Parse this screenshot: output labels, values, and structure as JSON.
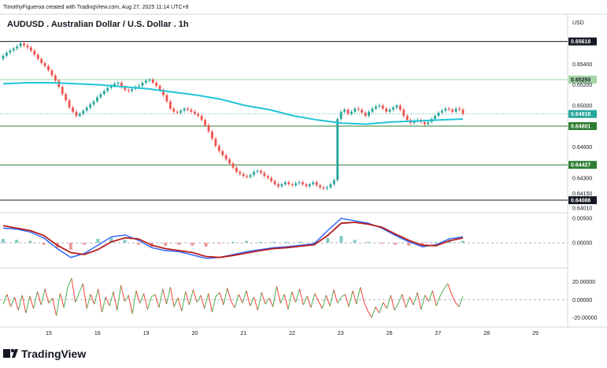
{
  "header": {
    "credit": "TimothyFigueroa created with TradingView.com, Aug 27, 2025 11:14 UTC+8",
    "symbol_title": "AUDUSD . Australian Dollar / U.S. Dollar . 1h",
    "currency": "USD"
  },
  "footer": {
    "logo_text": "TradingView"
  },
  "colors": {
    "up_candle": "#26a69a",
    "down_candle": "#ef5350",
    "sma": "#22c4d8",
    "resistance": "#a5d6a7",
    "support": "#2e7d32",
    "macd": "#2962ff",
    "signal": "#2e9f3a",
    "signal_dn": "#b71c1c",
    "osc_up": "#4caf50",
    "osc_dn": "#f44336"
  },
  "chart_data": [
    {
      "type": "candlestick",
      "symbol": "AUDUSD",
      "interval": "1h",
      "x_tick_labels": [
        "15",
        "16",
        "19",
        "20",
        "21",
        "22",
        "23",
        "26",
        "27",
        "28",
        "29"
      ],
      "y_tick_labels": [
        "0.65400",
        "0.65200",
        "0.65000",
        "0.64600",
        "0.64300",
        "0.64150",
        "0.64010"
      ],
      "ylim": [
        0.6398,
        0.6579
      ],
      "horizontal_levels": [
        {
          "value": 0.65618,
          "label": "0.65618",
          "style": "black"
        },
        {
          "value": 0.6525,
          "label": "0.65250",
          "style": "light-green"
        },
        {
          "value": 0.64801,
          "label": "0.64801",
          "style": "green"
        },
        {
          "value": 0.64427,
          "label": "0.64427",
          "style": "green"
        },
        {
          "value": 0.64086,
          "label": "0.64086",
          "style": "black"
        }
      ],
      "last_price": {
        "value": 0.64918,
        "label": "0.64918"
      },
      "close_series": [
        0.6548,
        0.6551,
        0.6553,
        0.6555,
        0.6557,
        0.656,
        0.6558,
        0.6556,
        0.6553,
        0.6549,
        0.6545,
        0.6541,
        0.6538,
        0.6534,
        0.6529,
        0.6524,
        0.6518,
        0.6511,
        0.6505,
        0.6498,
        0.6494,
        0.649,
        0.6492,
        0.6495,
        0.6498,
        0.6501,
        0.6504,
        0.6508,
        0.6511,
        0.6514,
        0.6517,
        0.6519,
        0.6521,
        0.6522,
        0.6518,
        0.6515,
        0.6514,
        0.6516,
        0.6518,
        0.6519,
        0.6522,
        0.6524,
        0.6525,
        0.6522,
        0.6519,
        0.6515,
        0.651,
        0.6504,
        0.6497,
        0.6494,
        0.6493,
        0.6495,
        0.6497,
        0.6496,
        0.6494,
        0.6492,
        0.649,
        0.6486,
        0.6481,
        0.6475,
        0.6468,
        0.6461,
        0.6456,
        0.6452,
        0.6448,
        0.6444,
        0.644,
        0.6436,
        0.6434,
        0.6432,
        0.6431,
        0.6433,
        0.6436,
        0.6437,
        0.6435,
        0.6432,
        0.643,
        0.6427,
        0.6424,
        0.6422,
        0.6424,
        0.6426,
        0.6424,
        0.6423,
        0.6425,
        0.6426,
        0.6424,
        0.6422,
        0.6424,
        0.6426,
        0.6423,
        0.6421,
        0.642,
        0.6421,
        0.6424,
        0.6428,
        0.6487,
        0.6494,
        0.6496,
        0.6492,
        0.6494,
        0.6497,
        0.6496,
        0.6493,
        0.649,
        0.6494,
        0.6497,
        0.6499,
        0.65,
        0.6497,
        0.6494,
        0.6496,
        0.6498,
        0.65,
        0.6496,
        0.649,
        0.6486,
        0.6483,
        0.6485,
        0.6486,
        0.6484,
        0.6482,
        0.6484,
        0.6487,
        0.649,
        0.6493,
        0.6495,
        0.6497,
        0.6496,
        0.6494,
        0.6497,
        0.6496,
        0.6492
      ],
      "sma_series": [
        0.6521,
        0.6522,
        0.6522,
        0.6521,
        0.652,
        0.6518,
        0.6516,
        0.6513,
        0.651,
        0.6506,
        0.65,
        0.6496,
        0.649,
        0.6486,
        0.6483,
        0.6482,
        0.6484,
        0.6485,
        0.6486,
        0.6487
      ]
    },
    {
      "type": "line",
      "name": "MACD",
      "y_tick_labels": [
        "0.00500",
        "0.00000"
      ],
      "ylim": [
        -0.0045,
        0.0055
      ],
      "series": [
        {
          "values": [
            0.003,
            0.0028,
            0.0022,
            0.001,
            -0.0012,
            -0.003,
            -0.0022,
            -0.0005,
            0.0012,
            0.0016,
            0.0005,
            -0.001,
            -0.0016,
            -0.0018,
            -0.0025,
            -0.0032,
            -0.003,
            -0.0024,
            -0.0018,
            -0.0014,
            -0.001,
            -0.0008,
            -0.0005,
            -0.0002,
            0.0025,
            0.005,
            0.0045,
            0.004,
            0.003,
            0.0015,
            0.0002,
            -0.0008,
            -0.0004,
            0.0008,
            0.0012
          ]
        },
        {
          "values": [
            0.0035,
            0.003,
            0.0025,
            0.0015,
            -0.0005,
            -0.002,
            -0.0024,
            -0.0014,
            0.0002,
            0.001,
            0.0008,
            -0.0005,
            -0.0012,
            -0.0016,
            -0.002,
            -0.0028,
            -0.003,
            -0.0026,
            -0.0021,
            -0.0016,
            -0.0012,
            -0.001,
            -0.0007,
            -0.0004,
            0.0015,
            0.004,
            0.0042,
            0.0038,
            0.0032,
            0.0018,
            0.0005,
            -0.0005,
            -0.0006,
            0.0004,
            0.001
          ]
        }
      ],
      "histogram": [
        0.0008,
        0.0006,
        0.0004,
        -0.0004,
        -0.001,
        -0.0014,
        -0.0004,
        0.0008,
        0.001,
        0.0006,
        -0.0004,
        -0.0008,
        -0.0006,
        -0.0004,
        -0.0006,
        -0.0008,
        -0.0002,
        0.0002,
        0.0004,
        0.0002,
        0.0002,
        0.0002,
        0.0002,
        0.0002,
        0.001,
        0.0014,
        0.0006,
        0.0002,
        -0.0002,
        -0.0004,
        -0.0006,
        -0.0004,
        0.0002,
        0.0006,
        0.0004
      ]
    },
    {
      "type": "line",
      "name": "Oscillator",
      "y_tick_labels": [
        "20.00000",
        "0.00000",
        "-20.00000"
      ],
      "ylim": [
        -28,
        32
      ],
      "values": [
        -5,
        6,
        -8,
        3,
        -12,
        5,
        -15,
        4,
        -10,
        9,
        -6,
        12,
        -4,
        2,
        -18,
        7,
        -9,
        14,
        24,
        -3,
        8,
        18,
        -10,
        6,
        -5,
        12,
        -14,
        3,
        -7,
        9,
        -12,
        16,
        -2,
        5,
        -16,
        10,
        -4,
        7,
        -11,
        3,
        6,
        -9,
        12,
        -5,
        14,
        -8,
        2,
        -13,
        9,
        -6,
        11,
        -3,
        5,
        -10,
        7,
        -14,
        4,
        8,
        -6,
        13,
        -2,
        -9,
        6,
        -4,
        10,
        -7,
        3,
        -12,
        8,
        -5,
        2,
        -8,
        15,
        -4,
        6,
        -11,
        9,
        -3,
        12,
        -6,
        4,
        -9,
        7,
        -2,
        -10,
        5,
        -7,
        11,
        -4,
        3,
        6,
        -8,
        10,
        -5,
        14,
        -3,
        -13,
        -20,
        -8,
        -15,
        -3,
        -10,
        5,
        -12,
        -4,
        6,
        -9,
        3,
        -6,
        8,
        -11,
        5,
        -2,
        10,
        -7,
        4,
        12,
        18,
        6,
        -3,
        -8,
        4
      ]
    }
  ]
}
